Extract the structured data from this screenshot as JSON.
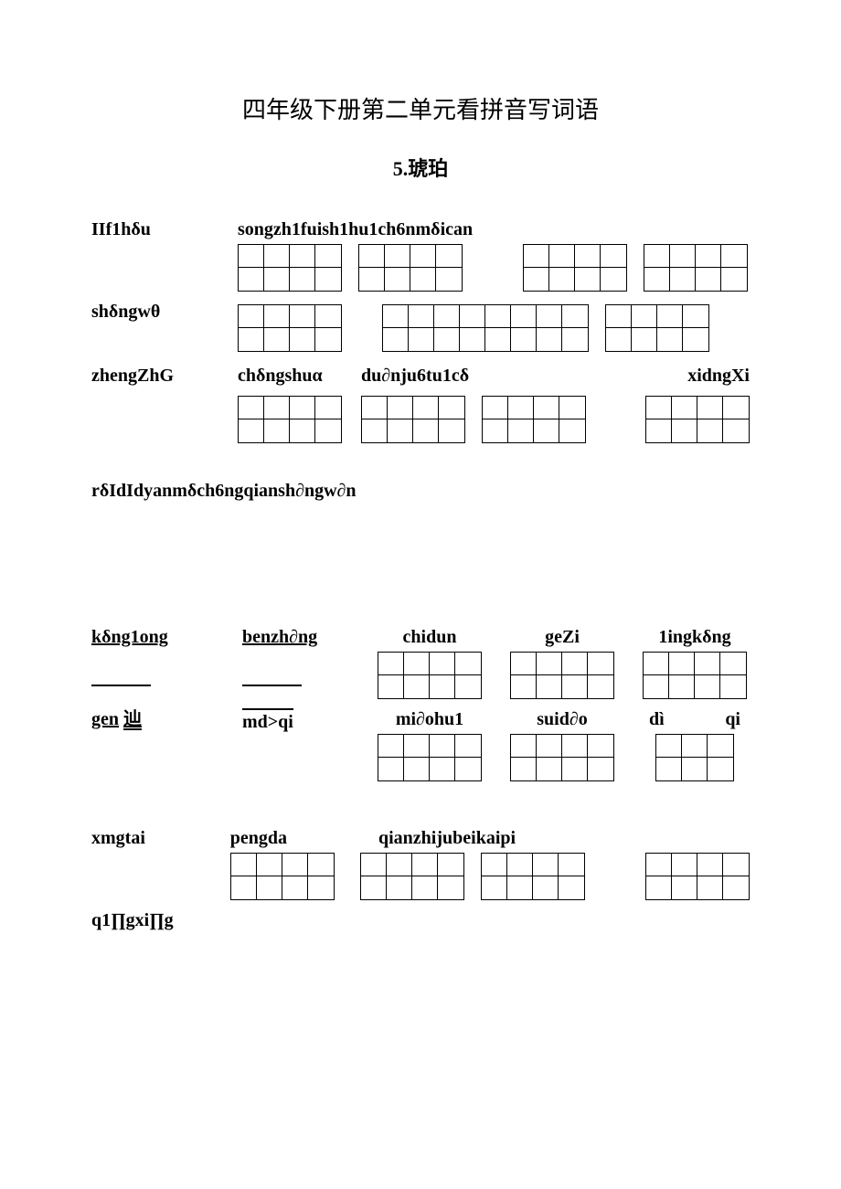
{
  "title": "四年级下册第二单元看拼音写词语",
  "subtitle": "5.琥珀",
  "row1": {
    "left": "IIf1hδu",
    "right_label": "songzh1fuish1hu1ch6nmδican"
  },
  "row2": {
    "left": "shδngwθ"
  },
  "row3": {
    "left": "zhengZhG",
    "mid1": "chδngshuα",
    "mid2": "du∂nju6tu1cδ",
    "right": "xidngXi"
  },
  "row4": "rδIdIdyanmδch6ngqiansh∂ngw∂n",
  "row5": {
    "c1": "kδng1ong",
    "c2": "benzh∂ng",
    "c3": "chidun",
    "c4": "geZi",
    "c5": "1ingkδng"
  },
  "row6": {
    "c1a": "gen",
    "c1b": "辿",
    "c2": "md>qi",
    "c3": "mi∂ohu1",
    "c4": "suid∂o",
    "c5a": "dì",
    "c5b": "qi"
  },
  "row7": {
    "c1": "xmgtai",
    "c2": "pengda",
    "c3": "qianzhijubeikaipi"
  },
  "row8": {
    "c1": "q1∏gxi∏g"
  }
}
